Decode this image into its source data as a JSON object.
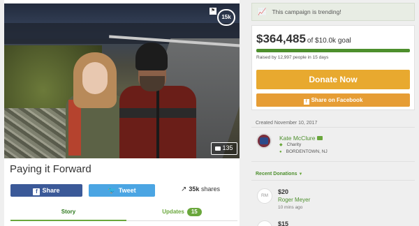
{
  "campaign": {
    "title": "Paying it Forward",
    "photo": {
      "hearts": "15k",
      "photo_count": "135"
    },
    "share": {
      "facebook_label": "Share",
      "twitter_label": "Tweet",
      "shares_count": "35k",
      "shares_label": "shares"
    },
    "tabs": {
      "story_label": "Story",
      "updates_label": "Updates",
      "updates_count": "15"
    }
  },
  "sidebar": {
    "trending_text": "This campaign is trending!",
    "raised_amount": "$364,485",
    "goal_text": "of $10.0k goal",
    "progress_percent": 100,
    "raised_by": "Raised by 12,997 people in 15 days",
    "donate_label": "Donate Now",
    "fb_share_label": "Share on Facebook",
    "created": "Created November 10, 2017",
    "organizer": {
      "name": "Kate McClure",
      "category": "Charity",
      "location": "BORDENTOWN, NJ"
    },
    "recent_donations_label": "Recent Donations",
    "donations": [
      {
        "initials": "RM",
        "amount": "$20",
        "name": "Roger Meyer",
        "time": "10 mins ago"
      },
      {
        "initials": "",
        "amount": "$15",
        "name": "",
        "time": ""
      }
    ]
  },
  "colors": {
    "accent_green": "#6aa73c",
    "donate_orange": "#e8a92f",
    "facebook_blue": "#3b5998",
    "twitter_blue": "#4ba5e3"
  }
}
